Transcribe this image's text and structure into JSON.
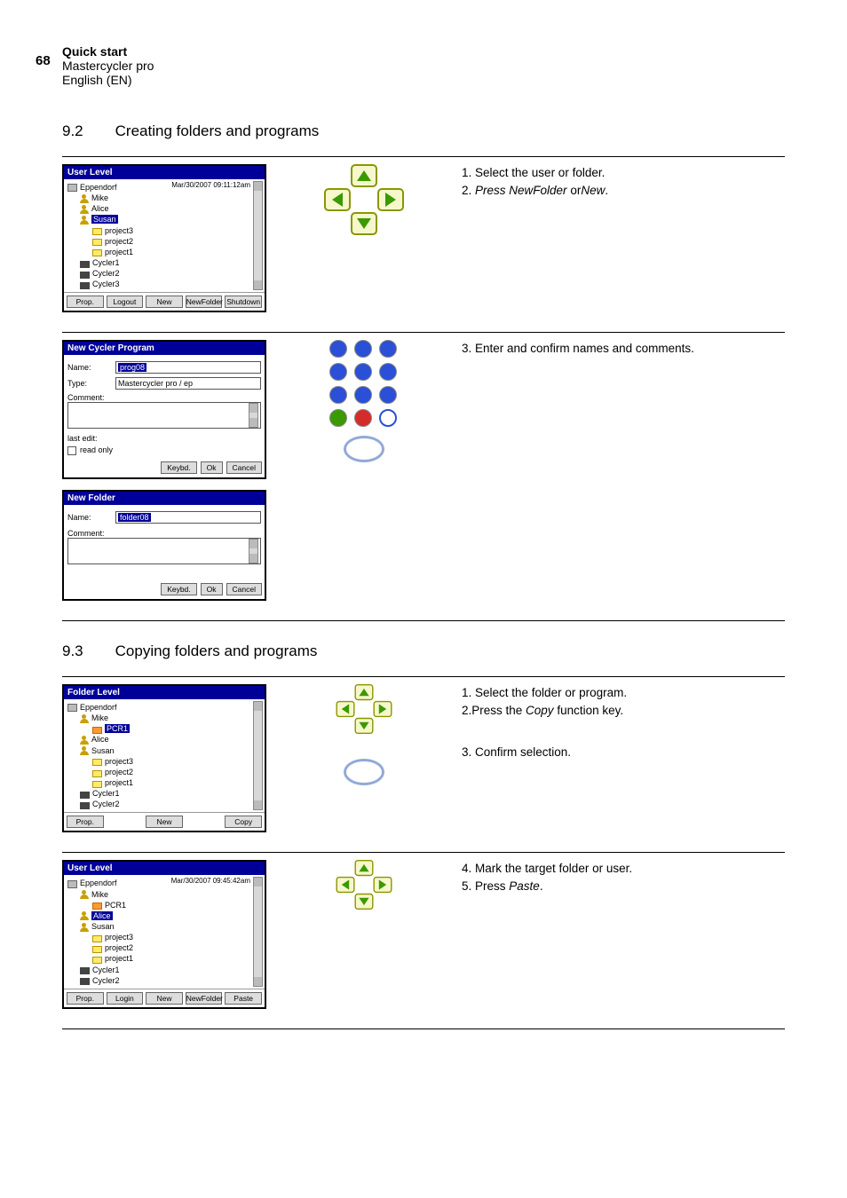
{
  "pageNumber": "68",
  "header": {
    "title": "Quick start",
    "line2": "Mastercycler pro",
    "line3": "English (EN)"
  },
  "sections": {
    "s92": {
      "num": "9.2",
      "title": "Creating folders and programs"
    },
    "s93": {
      "num": "9.3",
      "title": "Copying folders and programs"
    }
  },
  "win1": {
    "title": "User Level",
    "timestamp": "Mar/30/2007 09:11:12am",
    "root": "Eppendorf",
    "users": [
      "Mike",
      "Alice",
      "Susan"
    ],
    "susanSelected": "Susan",
    "projects": [
      "project3",
      "project2",
      "project1"
    ],
    "cyclers": [
      "Cycler1",
      "Cycler2",
      "Cycler3"
    ],
    "buttons": [
      "Prop.",
      "Logout",
      "New",
      "NewFolder",
      "Shutdown"
    ]
  },
  "step1": {
    "t1": "1. Select the user or folder.",
    "t2a": "2. ",
    "t2i": "Press NewFolder ",
    "t2b": "or",
    "t2ii": "New",
    "t2c": "."
  },
  "win2": {
    "title": "New Cycler Program",
    "labels": {
      "name": "Name:",
      "type": "Type:",
      "comment": "Comment:",
      "lastedit": "last edit:",
      "readonly": "read only"
    },
    "nameVal": "prog08",
    "typeVal": "Mastercycler pro / ep",
    "buttons": [
      "Keybd.",
      "Ok",
      "Cancel"
    ]
  },
  "win3": {
    "title": "New Folder",
    "labels": {
      "name": "Name:",
      "comment": "Comment:"
    },
    "nameVal": "folder08",
    "buttons": [
      "Keybd.",
      "Ok",
      "Cancel"
    ]
  },
  "step3": {
    "t": "3. Enter and confirm names and comments."
  },
  "win4": {
    "title": "Folder Level",
    "root": "Eppendorf",
    "mike": "Mike",
    "pcr1Sel": "PCR1",
    "alice": "Alice",
    "susan": "Susan",
    "projects": [
      "project3",
      "project2",
      "project1"
    ],
    "cyclers": [
      "Cycler1",
      "Cycler2"
    ],
    "buttons": [
      "Prop.",
      "New",
      "Copy"
    ]
  },
  "step93a": {
    "t1": "1. Select the folder or program.",
    "t2a": "2.Press the ",
    "t2i": "Copy",
    "t2b": " function key.",
    "t3": "3. Confirm selection."
  },
  "win5": {
    "title": "User Level",
    "timestamp": "Mar/30/2007 09:45:42am",
    "root": "Eppendorf",
    "mike": "Mike",
    "pcr1": "PCR1",
    "aliceSel": "Alice",
    "susan": "Susan",
    "projects": [
      "project3",
      "project2",
      "project1"
    ],
    "cyclers": [
      "Cycler1",
      "Cycler2"
    ],
    "buttons": [
      "Prop.",
      "Login",
      "New",
      "NewFolder",
      "Paste"
    ]
  },
  "step93b": {
    "t4": "4. Mark the target folder or user.",
    "t5a": "5. Press ",
    "t5i": "Paste",
    "t5b": "."
  }
}
